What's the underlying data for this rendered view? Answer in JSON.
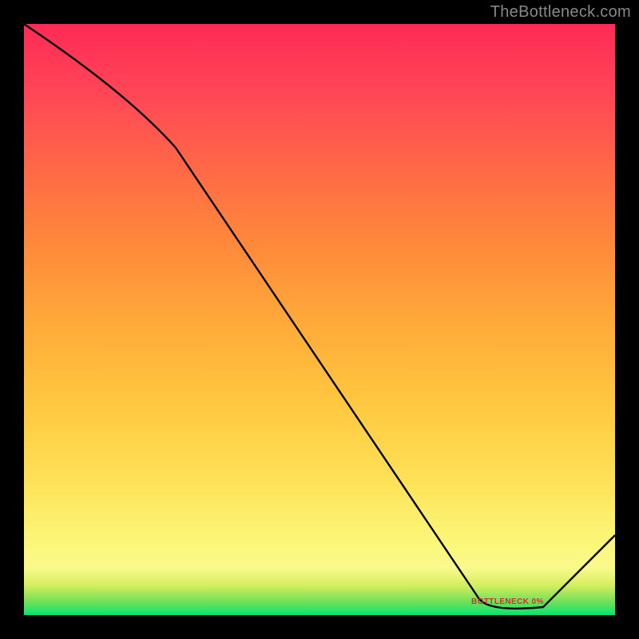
{
  "watermark": "TheBottleneck.com",
  "chart_data": {
    "type": "line",
    "title": "",
    "xlabel": "",
    "ylabel": "",
    "xlim": [
      0,
      100
    ],
    "ylim": [
      0,
      100
    ],
    "x": [
      0,
      25,
      80,
      88,
      100
    ],
    "values": [
      100,
      80,
      1,
      1,
      12
    ],
    "marker": {
      "x": 82,
      "y": 2,
      "label": "BOTTLENECK 0%"
    },
    "colors": {
      "line": "#000000",
      "gradient_top": "#ff2a55",
      "gradient_bottom": "#00e676"
    }
  }
}
